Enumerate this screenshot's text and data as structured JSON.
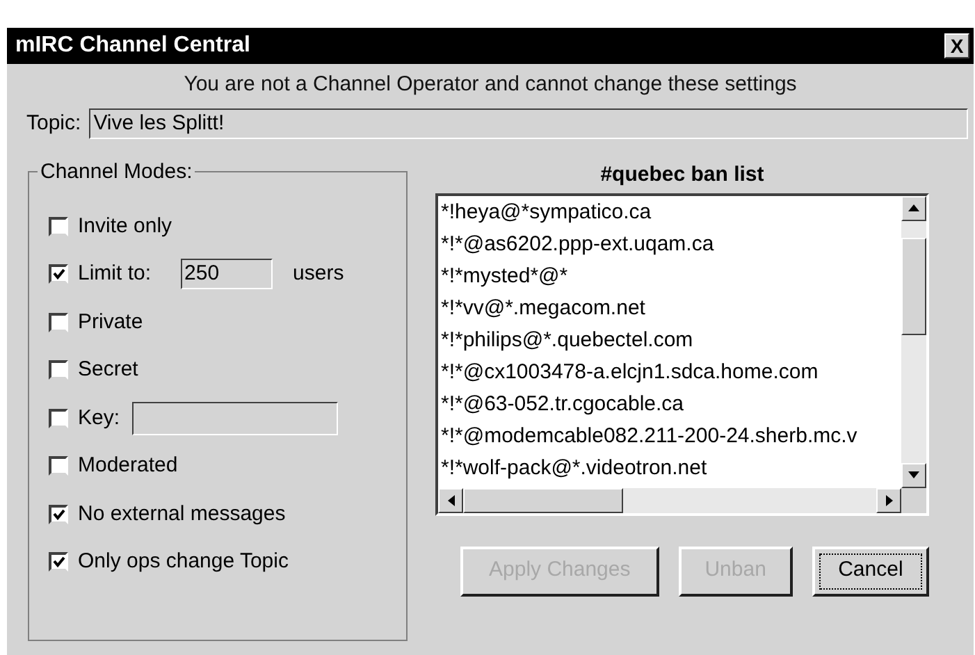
{
  "window": {
    "title": "mIRC Channel Central",
    "close": "X"
  },
  "notice": "You are not a Channel Operator and cannot change these settings",
  "topic": {
    "label": "Topic:",
    "value": "Vive les Splitt!"
  },
  "channel_modes": {
    "title": "Channel Modes:",
    "items": [
      {
        "kind": "check",
        "label": "Invite only",
        "checked": false
      },
      {
        "kind": "limit",
        "label": "Limit to:",
        "checked": true,
        "value": "250",
        "suffix": "users"
      },
      {
        "kind": "check",
        "label": "Private",
        "checked": false
      },
      {
        "kind": "check",
        "label": "Secret",
        "checked": false
      },
      {
        "kind": "key",
        "label": "Key:",
        "checked": false
      },
      {
        "kind": "check",
        "label": "Moderated",
        "checked": false
      },
      {
        "kind": "check",
        "label": "No external messages",
        "checked": true
      },
      {
        "kind": "check",
        "label": "Only ops change Topic",
        "checked": true
      }
    ]
  },
  "ban_list": {
    "title": "#quebec ban list",
    "items": [
      "*!heya@*sympatico.ca",
      "*!*@as6202.ppp-ext.uqam.ca",
      "*!*mysted*@*",
      "*!*vv@*.megacom.net",
      "*!*philips@*.quebectel.com",
      "*!*@cx1003478-a.elcjn1.sdca.home.com",
      "*!*@63-052.tr.cgocable.ca",
      "*!*@modemcable082.211-200-24.sherb.mc.v",
      "*!*wolf-pack@*.videotron.net"
    ]
  },
  "buttons": [
    {
      "label": "Apply Changes",
      "disabled": true
    },
    {
      "label": "Unban",
      "disabled": true
    },
    {
      "label": "Cancel",
      "disabled": false
    }
  ]
}
